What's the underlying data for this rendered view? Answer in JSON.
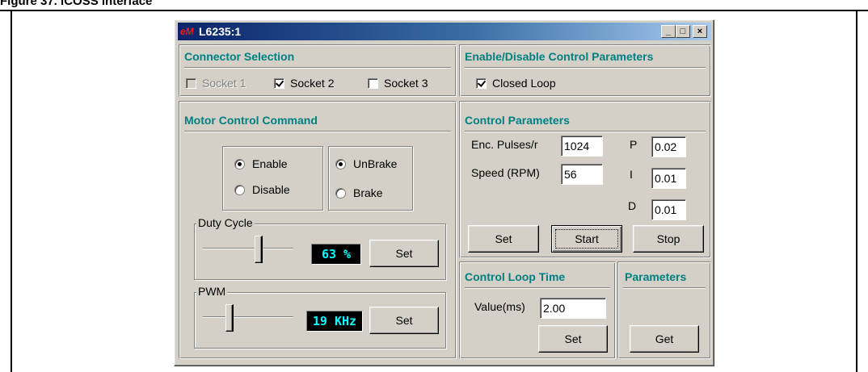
{
  "caption": "Figure 37. iCOSS interface",
  "window": {
    "title": "L6235:1",
    "logo_text": "eM",
    "minimize": "_",
    "maximize": "□",
    "close": "×"
  },
  "connector": {
    "title": "Connector Selection",
    "sockets": [
      {
        "label": "Socket 1",
        "checked": false,
        "enabled": false
      },
      {
        "label": "Socket 2",
        "checked": true,
        "enabled": true
      },
      {
        "label": "Socket 3",
        "checked": false,
        "enabled": true
      }
    ]
  },
  "enable_params": {
    "title": "Enable/Disable Control Parameters",
    "closed_loop_label": "Closed Loop",
    "closed_loop_checked": true
  },
  "motor": {
    "title": "Motor Control Command",
    "enable_label": "Enable",
    "disable_label": "Disable",
    "unbrake_label": "UnBrake",
    "brake_label": "Brake",
    "enable_selected": "Enable",
    "brake_selected": "UnBrake",
    "duty": {
      "legend": "Duty Cycle",
      "readout": "63 %",
      "value_percent": 63,
      "set_label": "Set"
    },
    "pwm": {
      "legend": "PWM",
      "readout": "19 KHz",
      "set_label": "Set"
    }
  },
  "control": {
    "title": "Control Parameters",
    "enc_label": "Enc. Pulses/r",
    "enc_value": "1024",
    "speed_label": "Speed (RPM)",
    "speed_value": "56",
    "p_label": "P",
    "p_value": "0.02",
    "i_label": "I",
    "i_value": "0.01",
    "d_label": "D",
    "d_value": "0.01",
    "set_label": "Set",
    "start_label": "Start",
    "stop_label": "Stop"
  },
  "loop_time": {
    "title": "Control Loop Time",
    "value_label": "Value(ms)",
    "value": "2.00",
    "set_label": "Set"
  },
  "parameters": {
    "title": "Parameters",
    "get_label": "Get"
  },
  "colors": {
    "panel_title": "#008080",
    "readout_text": "#00ffff",
    "window_face": "#d4d0c8",
    "title_gradient_start": "#0a246a"
  }
}
